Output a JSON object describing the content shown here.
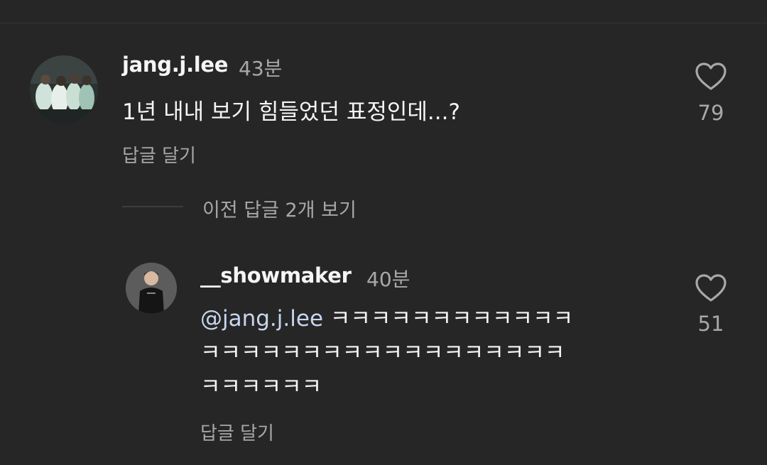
{
  "comment": {
    "username": "jang.j.lee",
    "time": "43분",
    "text": "1년 내내 보기 힘들었던 표정인데...?",
    "reply_action": "답글 달기",
    "like_count": "79",
    "avatar_icon": "team-photo-avatar"
  },
  "view_previous": {
    "label": "이전 답글 2개 보기"
  },
  "reply": {
    "username": "__showmaker",
    "time": "40분",
    "mention": "@jang.j.lee",
    "text_line1": " ㅋㅋㅋㅋㅋㅋㅋㅋㅋㅋㅋㅋ",
    "text_line2": "ㅋㅋㅋㅋㅋㅋㅋㅋㅋㅋㅋㅋㅋㅋㅋㅋㅋㅋ",
    "text_line3": "ㅋㅋㅋㅋㅋㅋ",
    "reply_action": "답글 달기",
    "like_count": "51",
    "avatar_icon": "person-avatar"
  },
  "colors": {
    "background": "#262626",
    "text_primary": "#f5f5f5",
    "text_secondary": "#a8a8a8",
    "mention": "#c7d6f0"
  }
}
